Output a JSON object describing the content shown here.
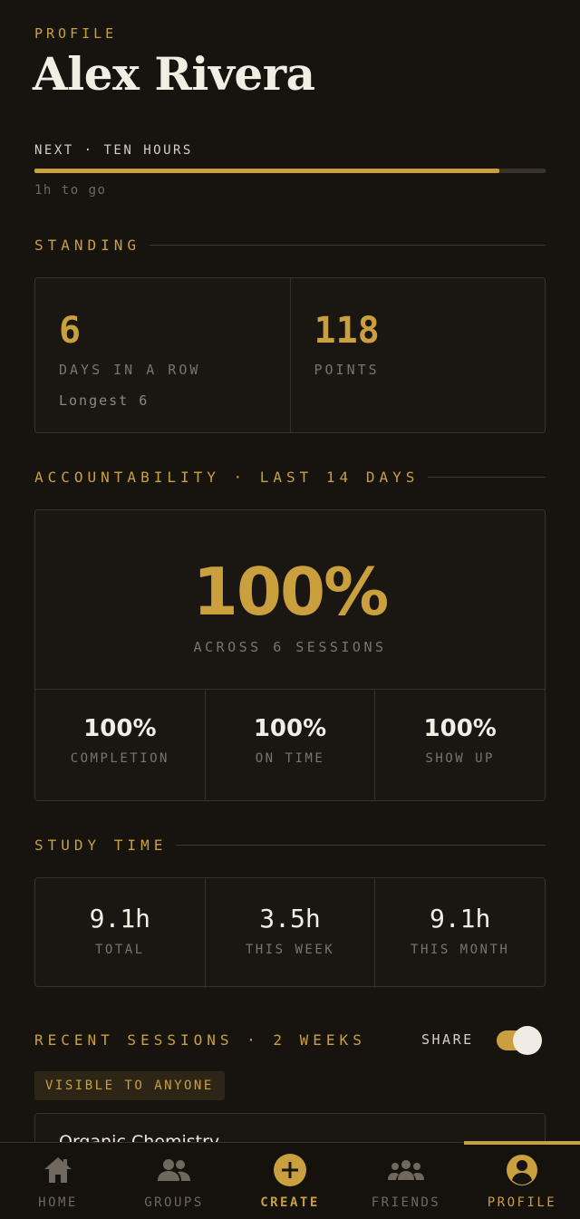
{
  "header": {
    "eyebrow": "PROFILE",
    "name": "Alex Rivera"
  },
  "progress": {
    "label": "NEXT · TEN HOURS",
    "fraction": 0.91,
    "to_go": "1h to go"
  },
  "standing": {
    "title": "STANDING",
    "streak": {
      "value": "6",
      "label": "DAYS IN A ROW",
      "sub": "Longest 6"
    },
    "points": {
      "value": "118",
      "label": "POINTS"
    }
  },
  "accountability": {
    "title": "ACCOUNTABILITY · LAST 14 DAYS",
    "percent": "100%",
    "sessions_text": "ACROSS 6 SESSIONS",
    "stats": [
      {
        "value": "100%",
        "label": "COMPLETION"
      },
      {
        "value": "100%",
        "label": "ON TIME"
      },
      {
        "value": "100%",
        "label": "SHOW UP"
      }
    ]
  },
  "study_time": {
    "title": "STUDY TIME",
    "stats": [
      {
        "value": "9.1h",
        "label": "TOTAL"
      },
      {
        "value": "3.5h",
        "label": "THIS WEEK"
      },
      {
        "value": "9.1h",
        "label": "THIS MONTH"
      }
    ]
  },
  "recent": {
    "title": "RECENT SESSIONS · 2 WEEKS",
    "share_label": "SHARE",
    "share_on": true,
    "visibility_badge": "VISIBLE TO ANYONE",
    "first_session_title": "Organic Chemistry"
  },
  "tabs": [
    {
      "label": "HOME",
      "icon": "home-icon"
    },
    {
      "label": "GROUPS",
      "icon": "groups-icon"
    },
    {
      "label": "CREATE",
      "icon": "plus-circle-icon"
    },
    {
      "label": "FRIENDS",
      "icon": "friends-icon"
    },
    {
      "label": "PROFILE",
      "icon": "user-circle-icon",
      "active": true
    }
  ],
  "colors": {
    "background": "#17130f",
    "accent": "#c9a03d",
    "text": "#f3eee4",
    "muted": "#7b7468"
  }
}
